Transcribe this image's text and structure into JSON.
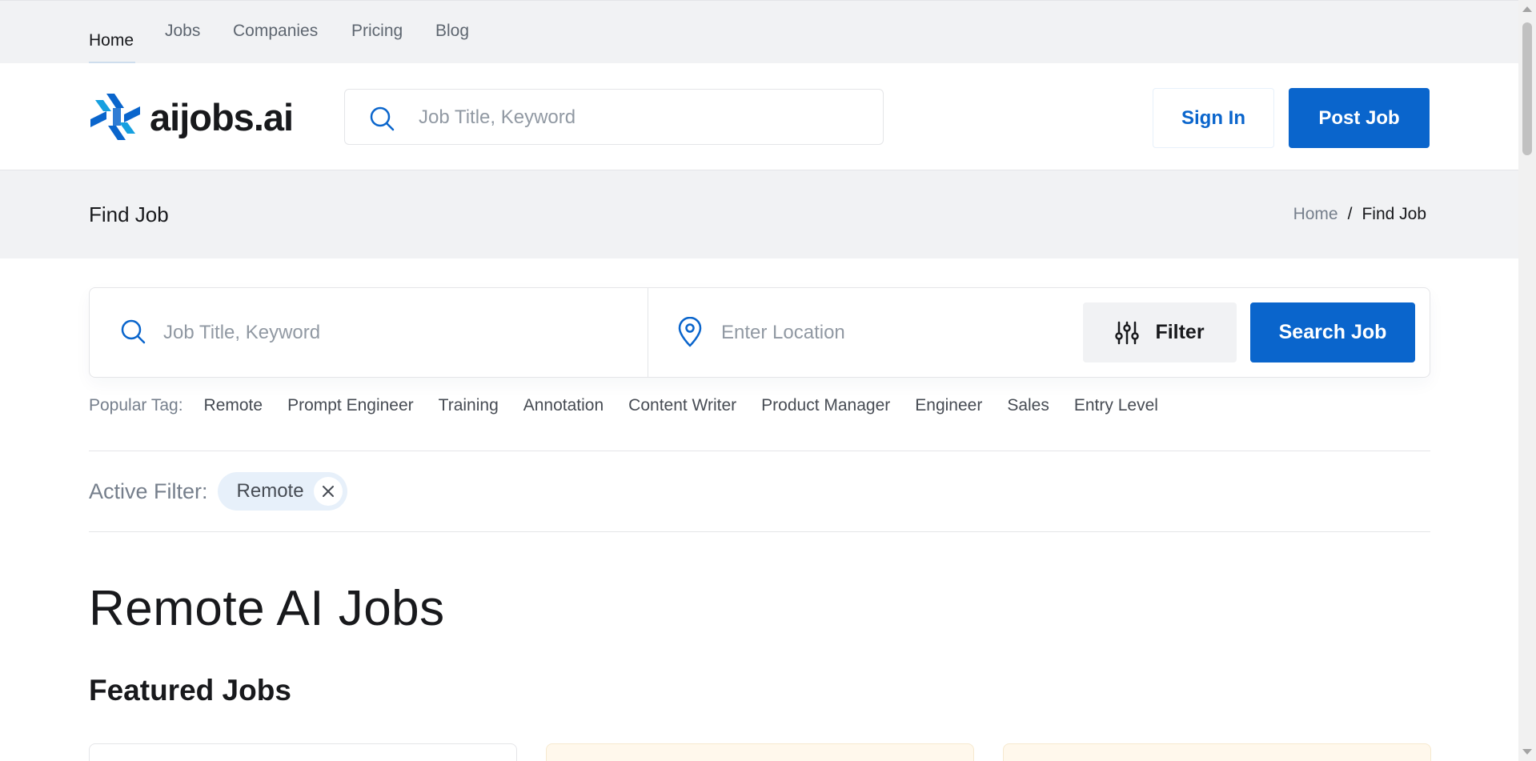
{
  "topnav": {
    "items": [
      {
        "label": "Home"
      },
      {
        "label": "Jobs"
      },
      {
        "label": "Companies"
      },
      {
        "label": "Pricing"
      },
      {
        "label": "Blog"
      }
    ]
  },
  "header": {
    "logo_text": "aijobs.ai",
    "search_placeholder": "Job Title, Keyword",
    "signin_label": "Sign In",
    "post_label": "Post Job"
  },
  "band": {
    "title": "Find Job",
    "breadcrumb": {
      "home": "Home",
      "sep": "/",
      "current": "Find Job"
    }
  },
  "search": {
    "keyword_placeholder": "Job Title, Keyword",
    "location_placeholder": "Enter Location",
    "filter_label": "Filter",
    "search_label": "Search Job"
  },
  "popular": {
    "label": "Popular Tag:",
    "tags": [
      "Remote",
      "Prompt Engineer",
      "Training",
      "Annotation",
      "Content Writer",
      "Product Manager",
      "Engineer",
      "Sales",
      "Entry Level"
    ]
  },
  "active_filter": {
    "label": "Active Filter:",
    "chip": "Remote"
  },
  "main": {
    "heading": "Remote AI Jobs",
    "subheading": "Featured Jobs"
  },
  "colors": {
    "accent": "#0a65cc",
    "band": "#f1f2f4",
    "chip": "#e7f0fa"
  }
}
